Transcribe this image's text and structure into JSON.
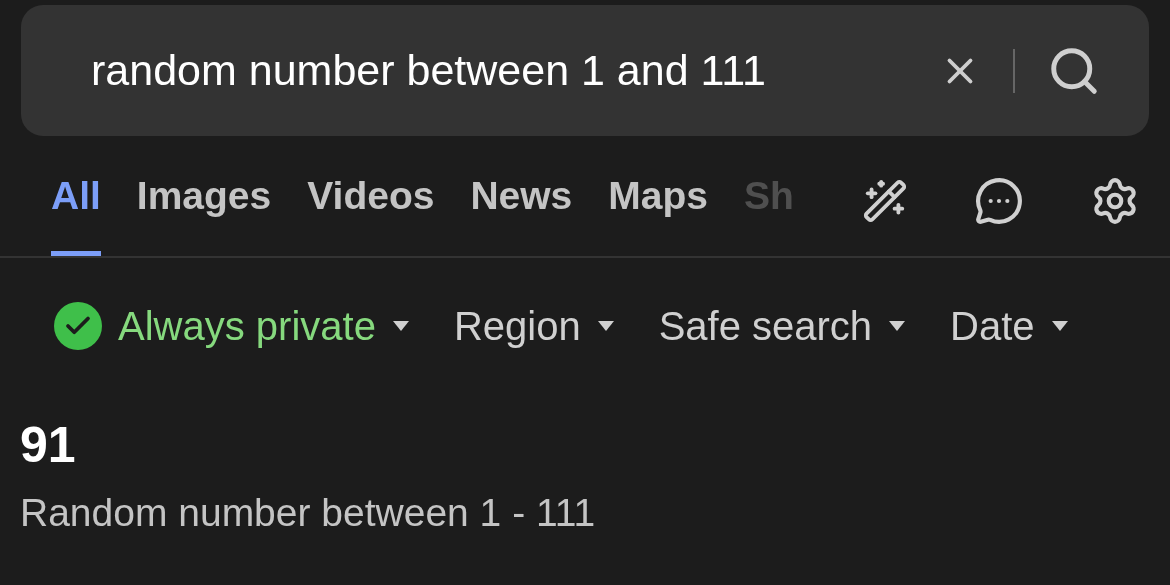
{
  "search": {
    "value": "random number between 1 and 111"
  },
  "tabs": [
    {
      "label": "All",
      "selected": true,
      "cut": false
    },
    {
      "label": "Images",
      "selected": false,
      "cut": false
    },
    {
      "label": "Videos",
      "selected": false,
      "cut": false
    },
    {
      "label": "News",
      "selected": false,
      "cut": false
    },
    {
      "label": "Maps",
      "selected": false,
      "cut": false
    },
    {
      "label": "Sh",
      "selected": false,
      "cut": true
    }
  ],
  "filters": [
    {
      "label": "Always private",
      "kind": "privacy"
    },
    {
      "label": "Region",
      "kind": "dropdown"
    },
    {
      "label": "Safe search",
      "kind": "dropdown"
    },
    {
      "label": "Date",
      "kind": "dropdown"
    }
  ],
  "result": {
    "value": "91",
    "description": "Random number between 1 - 111"
  }
}
